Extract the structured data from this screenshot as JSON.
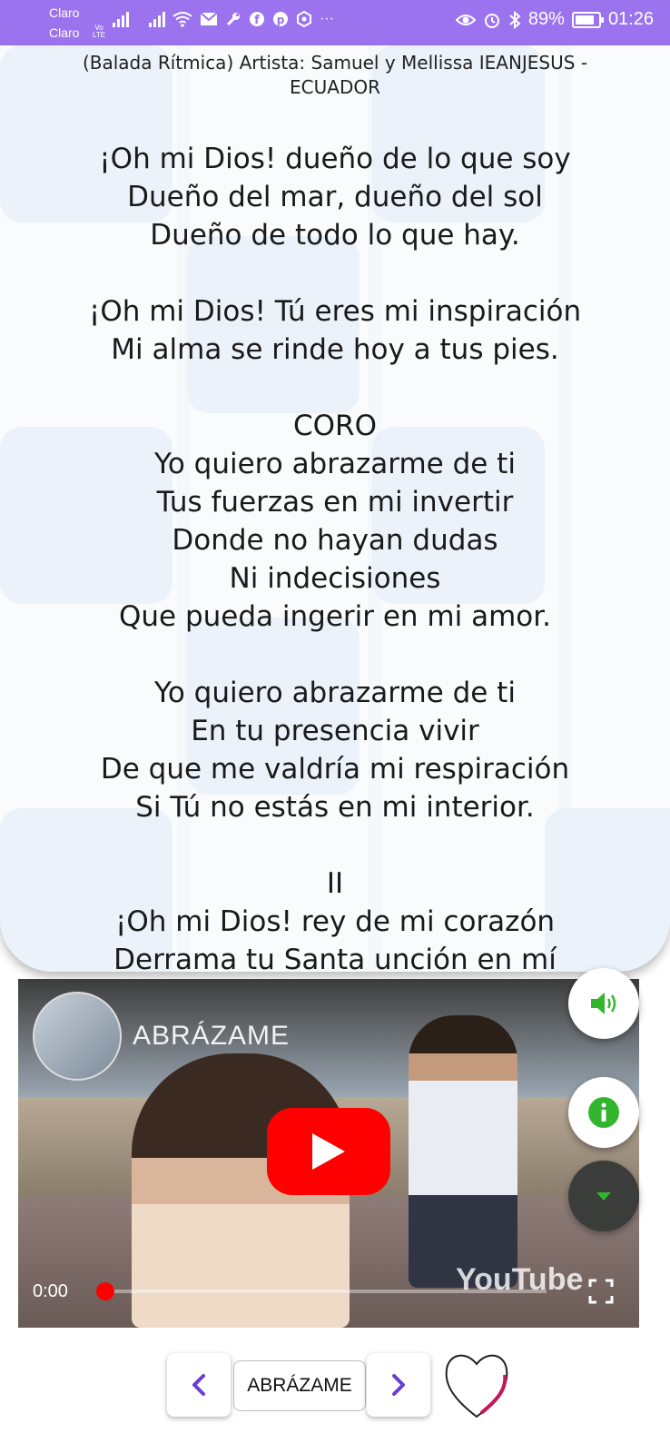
{
  "status_bar": {
    "carrier_1": "Claro",
    "carrier_2": "Claro",
    "volte_top": "Vo",
    "volte_bottom": "LTE",
    "more": "···",
    "battery": "89%",
    "time": "01:26"
  },
  "song": {
    "subtitle": "(Balada Rítmica) Artista: Samuel y Mellissa  IEANJESUS - ECUADOR",
    "lyrics": [
      "¡Oh mi Dios! dueño de lo que soy",
      "Dueño del mar, dueño del sol",
      "Dueño de todo lo que hay.",
      "",
      "¡Oh mi Dios! Tú eres mi inspiración",
      "Mi alma se rinde hoy a tus pies.",
      "",
      "CORO",
      "Yo quiero abrazarme de ti",
      "Tus fuerzas en mi invertir",
      "Donde no hayan dudas",
      "Ni indecisiones",
      "Que pueda ingerir en mi amor.",
      "",
      "Yo quiero abrazarme de ti",
      "En tu presencia vivir",
      "De que me valdría mi respiración",
      "Si Tú no estás en mi interior.",
      "",
      "II",
      "¡Oh mi Dios! rey de mi corazón",
      "Derrama tu Santa unción en mí"
    ]
  },
  "video": {
    "title": "ABRÁZAME",
    "current_time": "0:00",
    "progress": 0,
    "logo": "YouTube"
  },
  "fabs": {
    "sound_icon": "speaker-icon",
    "info_icon": "info-icon",
    "down_icon": "caret-down-icon"
  },
  "bottom_nav": {
    "song_name": "ABRÁZAME",
    "prev_icon": "chevron-left-icon",
    "next_icon": "chevron-right-icon",
    "favorite_icon": "heart-icon"
  },
  "colors": {
    "status_bar": "#9b73ee",
    "accent_purple": "#6a3fd0",
    "fab_green": "#33b62e",
    "youtube_red": "#ff0000"
  }
}
